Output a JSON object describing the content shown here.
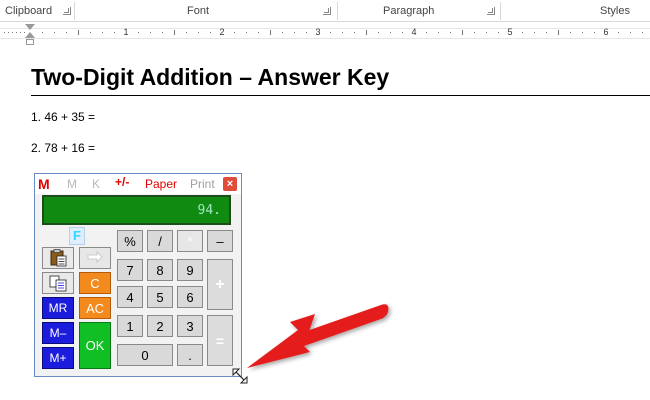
{
  "ribbon": {
    "groups": [
      "Clipboard",
      "Font",
      "Paragraph",
      "Styles"
    ]
  },
  "ruler": {
    "numbers": [
      "1",
      "2",
      "3",
      "4",
      "5",
      "6"
    ]
  },
  "document": {
    "title": "Two-Digit Addition – Answer Key",
    "questions": [
      "1. 46 + 35 =",
      "2. 78 + 16 ="
    ]
  },
  "calculator": {
    "menu": {
      "memory": "M",
      "m": "M",
      "k": "K",
      "plus_minus": "+/-",
      "paper": "Paper",
      "print": "Print",
      "close": "×"
    },
    "display_value": "94.",
    "f_tab": "F",
    "keys": {
      "percent": "%",
      "divide": "/",
      "multiply": "*",
      "minus": "–",
      "plus": "+",
      "equals": "=",
      "seven": "7",
      "eight": "8",
      "nine": "9",
      "four": "4",
      "five": "5",
      "six": "6",
      "one": "1",
      "two": "2",
      "three": "3",
      "zero": "0",
      "decimal": ".",
      "clear": "C",
      "all_clear": "AC",
      "memory_recall": "MR",
      "memory_minus": "M–",
      "memory_plus": "M+",
      "ok": "OK"
    },
    "colors": {
      "display_bg": "#108a10",
      "display_text": "#9fe8c0",
      "orange": "#f28a1e",
      "blue": "#1c1cdc",
      "green": "#0fbf24",
      "red": "#e00000"
    }
  },
  "annotation": {
    "arrow_color": "#e51b1b"
  }
}
